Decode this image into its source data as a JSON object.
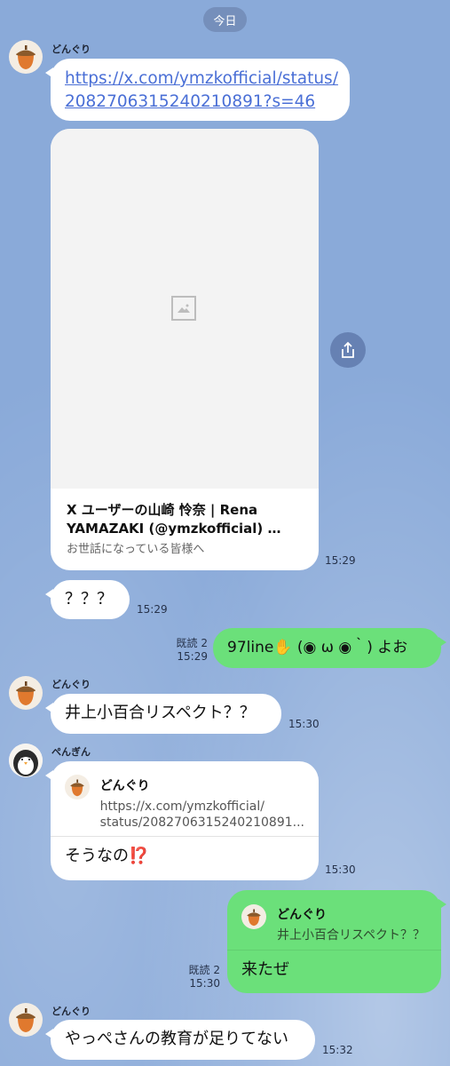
{
  "date_label": "今日",
  "users": {
    "acorn": "どんぐり",
    "penguin": "ぺんぎん"
  },
  "msg1": {
    "link_line1": "https://x.com/ymzkofficial/status/",
    "link_line2": "2082706315240210891?s=46"
  },
  "preview": {
    "title_line1": "X ユーザーの山崎 怜奈 | Rena",
    "title_line2": "YAMAZAKI (@ymzkofficial) …",
    "desc": "お世話になっている皆様へ",
    "time": "15:29"
  },
  "msg2": {
    "text": "？？？",
    "time": "15:29"
  },
  "msg3": {
    "read": "既読 2",
    "time": "15:29",
    "text": "97line✋ (◉ ω ◉｀) よお"
  },
  "msg4": {
    "text": "井上小百合リスペクト？？",
    "time": "15:30"
  },
  "msg5": {
    "quote_line1": "https://x.com/ymzkofficial/",
    "quote_line2": "status/2082706315240210891...",
    "text": "そうなの",
    "emoji": "⁉️",
    "time": "15:30"
  },
  "msg6": {
    "quote_text": "井上小百合リスペクト？？",
    "text": "来たぜ",
    "read": "既読 2",
    "time": "15:30"
  },
  "msg7": {
    "text": "やっぺさんの教育が足りてない",
    "time": "15:32"
  },
  "colors": {
    "background": "#8AAAD9",
    "my_bubble": "#6BE07A",
    "link": "#4A6FD6"
  }
}
